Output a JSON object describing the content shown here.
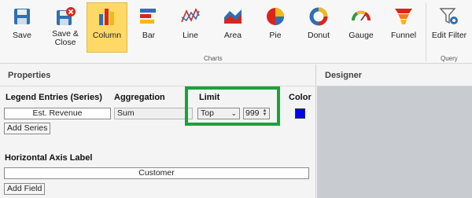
{
  "ribbon": {
    "buttons": [
      {
        "label": "Save",
        "icon": "save-icon"
      },
      {
        "label": "Save &\nClose",
        "icon": "save-close-icon"
      },
      {
        "label": "Column",
        "icon": "column-chart-icon",
        "active": true
      },
      {
        "label": "Bar",
        "icon": "bar-chart-icon"
      },
      {
        "label": "Line",
        "icon": "line-chart-icon"
      },
      {
        "label": "Area",
        "icon": "area-chart-icon"
      },
      {
        "label": "Pie",
        "icon": "pie-chart-icon"
      },
      {
        "label": "Donut",
        "icon": "donut-chart-icon"
      },
      {
        "label": "Gauge",
        "icon": "gauge-icon"
      },
      {
        "label": "Funnel",
        "icon": "funnel-chart-icon"
      },
      {
        "label": "Edit Filter",
        "icon": "filter-gear-icon"
      }
    ],
    "groups": {
      "charts": "Charts",
      "query": "Query"
    }
  },
  "properties": {
    "header": "Properties",
    "series_header": "Legend Entries (Series)",
    "aggregation_header": "Aggregation",
    "limit_header": "Limit",
    "color_header": "Color",
    "series_value": "Est. Revenue",
    "aggregation_value": "Sum",
    "limit_select": "Top",
    "limit_number": "999",
    "add_series": "Add Series",
    "axis_label_header": "Horizontal Axis Label",
    "axis_field_value": "Customer",
    "add_field": "Add Field",
    "series_color": "#0000ff",
    "highlight_color": "#19a33a"
  },
  "designer": {
    "header": "Designer"
  }
}
